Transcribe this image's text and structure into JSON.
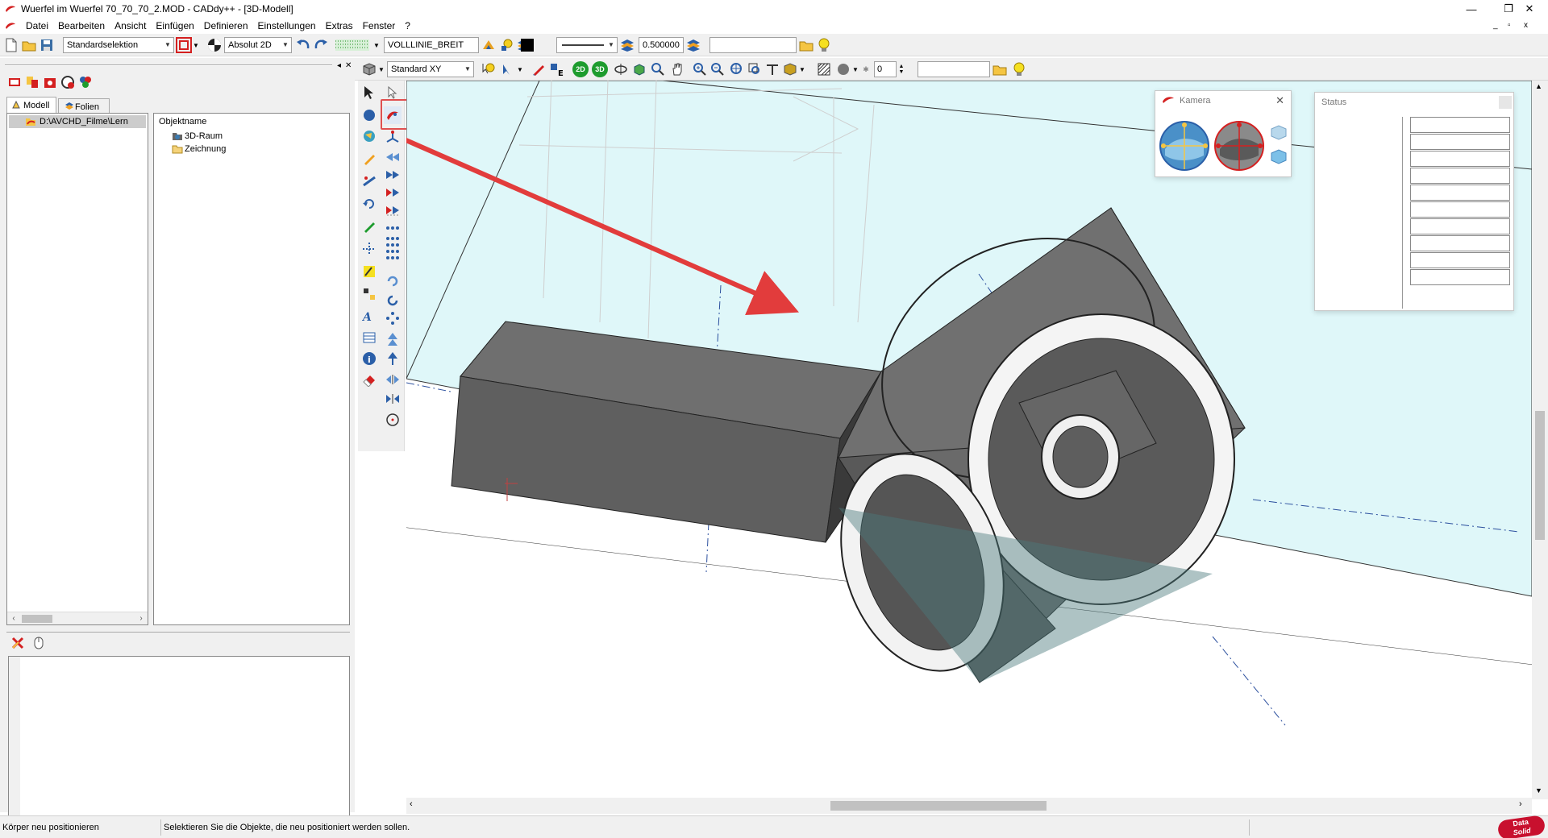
{
  "window": {
    "title": "Wuerfel im Wuerfel 70_70_70_2.MOD  -  CADdy++ - [3D-Modell]",
    "minimize": "—",
    "restore": "❐",
    "close": "✕"
  },
  "menu": {
    "items": [
      "Datei",
      "Bearbeiten",
      "Ansicht",
      "Einfügen",
      "Definieren",
      "Einstellungen",
      "Extras",
      "Fenster",
      "?"
    ],
    "mdi_controls": [
      "_",
      "▫",
      "x"
    ]
  },
  "toolbar1": {
    "selection_mode": "Standardselektion",
    "coord_mode": "Absolut 2D",
    "line_type": "VOLLLINIE_BREIT",
    "line_width": "0.500000",
    "layer_field": ""
  },
  "toolbar2": {
    "view_plane": "Standard XY",
    "spin_value": "0",
    "text_field": ""
  },
  "left_panel": {
    "tabs": [
      "Modell",
      "Folien"
    ],
    "tree_path": "D:\\AVCHD_Filme\\Lern",
    "objects_header": "Objektname",
    "objects": [
      "3D-Raum",
      "Zeichnung"
    ]
  },
  "camera_window": {
    "title": "Kamera"
  },
  "status_window": {
    "title": "Status"
  },
  "statusbar": {
    "command": "Körper neu positionieren",
    "prompt": "Selektieren Sie die Objekte, die neu positioniert werden sollen.",
    "logo_line1": "Data",
    "logo_line2": "Solid"
  },
  "colors": {
    "accent_red": "#e23c3c",
    "plane_cyan": "#dff7f9",
    "solid_gray": "#6a6a6a",
    "highlight_box": "#e05050"
  }
}
